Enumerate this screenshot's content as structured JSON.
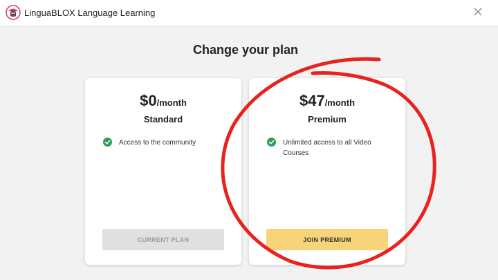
{
  "app": {
    "title": "LinguaBLOX Language Learning"
  },
  "page": {
    "title": "Change your plan"
  },
  "plans": [
    {
      "price": "$0",
      "period": "/month",
      "name": "Standard",
      "features": [
        "Access to the community"
      ],
      "button_label": "CURRENT PLAN"
    },
    {
      "price": "$47",
      "period": "/month",
      "name": "Premium",
      "features": [
        "Unlimited access to all Video Courses"
      ],
      "button_label": "JOIN PREMIUM"
    }
  ],
  "colors": {
    "check": "#2e9e55",
    "join_button": "#f7d37a",
    "current_button": "#e0e0e0",
    "annotation": "#e8231f"
  },
  "icons": {
    "app_logo": "app-logo-icon",
    "close": "close-icon",
    "check": "check-circle-icon"
  }
}
